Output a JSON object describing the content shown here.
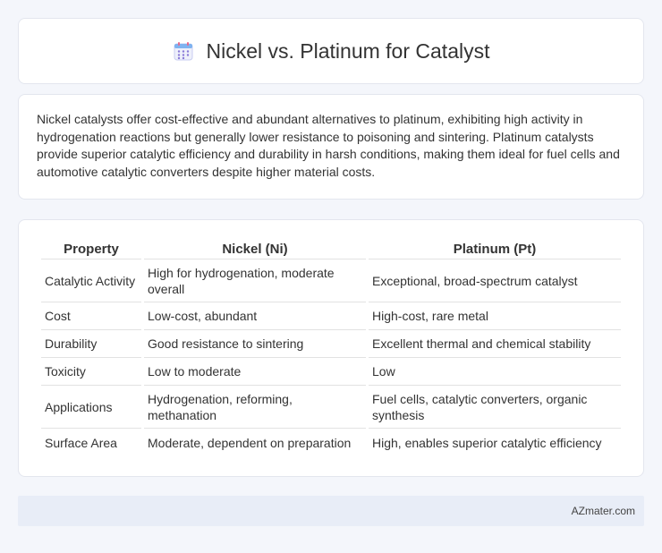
{
  "header": {
    "icon": "calendar-icon",
    "title": "Nickel vs. Platinum for Catalyst"
  },
  "summary": {
    "text": "Nickel catalysts offer cost-effective and abundant alternatives to platinum, exhibiting high activity in hydrogenation reactions but generally lower resistance to poisoning and sintering. Platinum catalysts provide superior catalytic efficiency and durability in harsh conditions, making them ideal for fuel cells and automotive catalytic converters despite higher material costs."
  },
  "table": {
    "headers": [
      "Property",
      "Nickel (Ni)",
      "Platinum (Pt)"
    ],
    "rows": [
      [
        "Catalytic Activity",
        "High for hydrogenation, moderate overall",
        "Exceptional, broad-spectrum catalyst"
      ],
      [
        "Cost",
        "Low-cost, abundant",
        "High-cost, rare metal"
      ],
      [
        "Durability",
        "Good resistance to sintering",
        "Excellent thermal and chemical stability"
      ],
      [
        "Toxicity",
        "Low to moderate",
        "Low"
      ],
      [
        "Applications",
        "Hydrogenation, reforming, methanation",
        "Fuel cells, catalytic converters, organic synthesis"
      ],
      [
        "Surface Area",
        "Moderate, dependent on preparation",
        "High, enables superior catalytic efficiency"
      ]
    ]
  },
  "footer": {
    "site": "AZmater.com"
  },
  "colors": {
    "page_bg": "#f4f6fb",
    "card_bg": "#ffffff",
    "footer_bg": "#e8edf7",
    "icon_accent": "#8a7ad8"
  }
}
